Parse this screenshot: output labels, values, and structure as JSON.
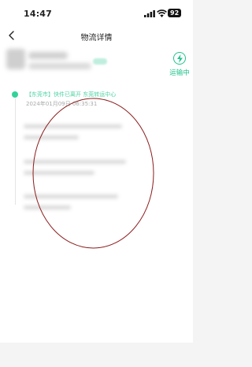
{
  "status_bar": {
    "time": "14:47",
    "battery": "92"
  },
  "nav": {
    "title": "物流详情"
  },
  "shipment": {
    "status_label": "运输中"
  },
  "timeline": {
    "events": [
      {
        "text": "【东莞市】快件已离开 东莞转运中心",
        "time": "2024年01月09日 06:35:31"
      }
    ]
  },
  "colors": {
    "accent": "#1fc38b",
    "annotation": "#8b1a1a"
  },
  "icons": {
    "back": "chevron-left-icon",
    "status": "lightning-icon"
  }
}
